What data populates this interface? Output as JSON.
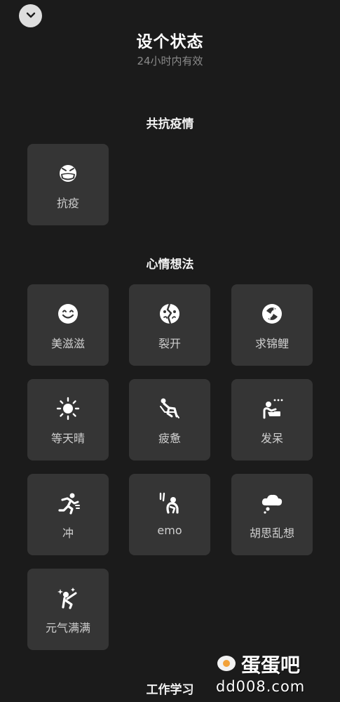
{
  "header": {
    "title": "设个状态",
    "subtitle": "24小时内有效"
  },
  "sections": [
    {
      "title": "共抗疫情",
      "items": [
        {
          "label": "抗疫",
          "icon": "mask-face-icon"
        }
      ]
    },
    {
      "title": "心情想法",
      "items": [
        {
          "label": "美滋滋",
          "icon": "smiley-face-icon"
        },
        {
          "label": "裂开",
          "icon": "cracked-face-icon"
        },
        {
          "label": "求锦鲤",
          "icon": "koi-fish-icon"
        },
        {
          "label": "等天晴",
          "icon": "sun-icon"
        },
        {
          "label": "疲惫",
          "icon": "slumped-person-icon"
        },
        {
          "label": "发呆",
          "icon": "daydream-person-icon"
        },
        {
          "label": "冲",
          "icon": "running-person-icon"
        },
        {
          "label": "emo",
          "icon": "crouching-person-icon"
        },
        {
          "label": "胡思乱想",
          "icon": "thought-cloud-icon"
        },
        {
          "label": "元气满满",
          "icon": "energetic-person-icon"
        }
      ]
    },
    {
      "title": "工作学习",
      "items": []
    }
  ],
  "watermark": {
    "logo_text": "蛋蛋吧",
    "url": "dd008.com"
  },
  "colors": {
    "background": "#1b1b1b",
    "tile": "#353535",
    "text_primary": "#ffffff",
    "text_secondary": "#8a8a8a"
  }
}
